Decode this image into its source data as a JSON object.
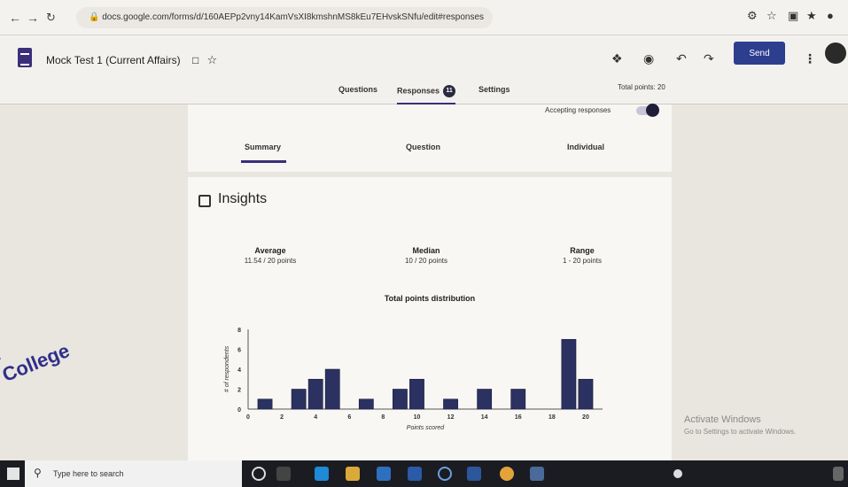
{
  "browser": {
    "url": "docs.google.com/forms/d/160AEPp2vny14KamVsXI8kmshnMS8kEu7EHvskSNfu/edit#responses",
    "back_icon": "arrow-left-icon",
    "forward_icon": "arrow-right-icon",
    "reload_icon": "reload-icon"
  },
  "form": {
    "title": "Mock Test 1 (Current Affairs)",
    "send_label": "Send",
    "total_points": "Total points: 20",
    "tabs": [
      {
        "label": "Questions"
      },
      {
        "label": "Responses",
        "count": "11"
      },
      {
        "label": "Settings"
      }
    ]
  },
  "responses": {
    "accepting_label": "Accepting responses",
    "subtabs": [
      {
        "label": "Summary"
      },
      {
        "label": "Question"
      },
      {
        "label": "Individual"
      }
    ]
  },
  "insights": {
    "title": "Insights",
    "average_label": "Average",
    "average_value": "11.54 / 20 points",
    "median_label": "Median",
    "median_value": "10 / 20 points",
    "range_label": "Range",
    "range_value": "1 - 20 points"
  },
  "chart_data": {
    "type": "bar",
    "title": "Total points distribution",
    "xlabel": "Points scored",
    "ylabel": "# of respondents",
    "x": [
      1,
      3,
      4,
      5,
      7,
      9,
      10,
      12,
      14,
      16,
      19,
      20
    ],
    "values": [
      1,
      2,
      3,
      4,
      1,
      2,
      3,
      1,
      2,
      2,
      7,
      3
    ],
    "xticks": [
      "0",
      "2",
      "4",
      "6",
      "8",
      "10",
      "12",
      "14",
      "16",
      "18",
      "20"
    ],
    "yticks": [
      "0",
      "2",
      "4",
      "6",
      "8"
    ],
    "xlim": [
      0,
      21
    ],
    "ylim": [
      0,
      8
    ],
    "bar_color": "#2b3160"
  },
  "overlay": {
    "watermark_line1": "l",
    "watermark_line2": "College",
    "activate_title": "Activate Windows",
    "activate_sub": "Go to Settings to activate Windows."
  },
  "taskbar": {
    "search_placeholder": "Type here to search"
  }
}
